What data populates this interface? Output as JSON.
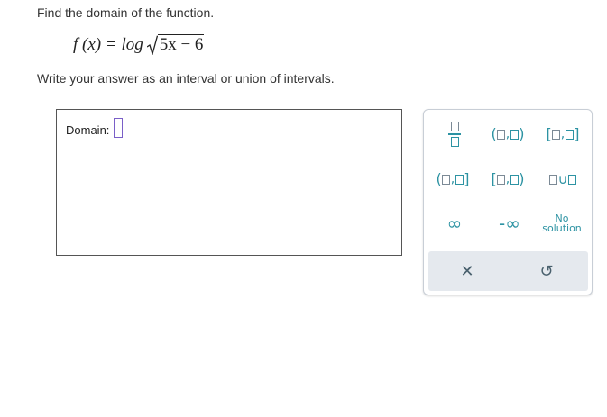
{
  "question": {
    "prompt": "Find the domain of the function.",
    "formula": {
      "lhs": "f (x) = log",
      "radicand": "5x − 6"
    },
    "instruction": "Write your answer as an interval or union of intervals."
  },
  "answer": {
    "label": "Domain:",
    "value": ""
  },
  "keypad": {
    "no_solution_line1": "No",
    "no_solution_line2": "solution",
    "infinity": "∞",
    "neg_infinity": "-∞",
    "clear_symbol": "✕",
    "undo_symbol": "↺",
    "union_symbol": "∪",
    "open_paren": "(",
    "close_paren": ")",
    "open_bracket": "[",
    "close_bracket": "]",
    "comma": ",",
    "accent_color": "#2d93a3",
    "input_border_color": "#7a5fc8"
  }
}
